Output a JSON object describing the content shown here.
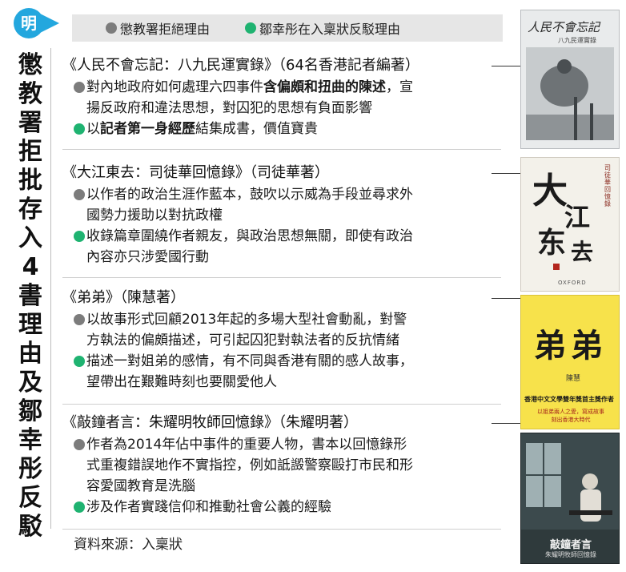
{
  "logo": {
    "text": "明",
    "color": "#23a7de"
  },
  "side_title": {
    "chars": [
      "懲",
      "教",
      "署",
      "拒",
      "批",
      "存",
      "入",
      "4",
      "書",
      "理",
      "由",
      "及",
      "鄒",
      "幸",
      "彤",
      "反",
      "駁"
    ]
  },
  "legend": {
    "grey_label": "懲教署拒絕理由",
    "green_label": "鄒幸彤在入稟狀反駁理由",
    "grey_color": "#7c7c7c",
    "green_color": "#1fb371"
  },
  "books": [
    {
      "title": "《人民不會忘記：八九民運實錄》（64名香港記者編著）",
      "reject_lines": [
        {
          "pre": "對內地政府如何處理六四事件",
          "bold": "含偏頗和扭曲的陳述",
          "post": "，宣"
        },
        {
          "pre": "揚反政府和違法思想，對囚犯的思想有負面影響",
          "bold": "",
          "post": ""
        }
      ],
      "rebut_lines": [
        {
          "pre": "以",
          "bold": "記者第一身經歷",
          "post": "結集成書，價值寶貴"
        }
      ],
      "cover": {
        "title": "人民不會忘記",
        "caption": "八九民運實錄"
      }
    },
    {
      "title": "《大江東去：司徒華回憶錄》（司徒華著）",
      "reject_lines": [
        {
          "pre": "以作者的政治生涯作藍本，鼓吹以示威為手段並尋求外",
          "bold": "",
          "post": ""
        },
        {
          "pre": "國勢力援助以對抗政權",
          "bold": "",
          "post": ""
        }
      ],
      "rebut_lines": [
        {
          "pre": "收錄篇章圍繞作者親友，與政治思想無關，即使有政治",
          "bold": "",
          "post": ""
        },
        {
          "pre": "內容亦只涉愛國行動",
          "bold": "",
          "post": ""
        }
      ],
      "cover": {
        "title_chars": [
          "大",
          "江",
          "东",
          "去"
        ],
        "caption": "司徒華回憶錄",
        "publisher": "OXFORD"
      }
    },
    {
      "title": "《弟弟》（陳慧著）",
      "reject_lines": [
        {
          "pre": "以故事形式回顧2013年起的多場大型社會動亂，對警",
          "bold": "",
          "post": ""
        },
        {
          "pre": "方執法的偏頗描述，可引起囚犯對執法者的反抗情緒",
          "bold": "",
          "post": ""
        }
      ],
      "rebut_lines": [
        {
          "pre": "描述一對姐弟的感情，有不同與香港有關的感人故事，",
          "bold": "",
          "post": ""
        },
        {
          "pre": "望帶出在艱難時刻也要關愛他人",
          "bold": "",
          "post": ""
        }
      ],
      "cover": {
        "title": "弟弟",
        "author": "陳慧",
        "award": "香港中文文學雙年獎首主獎作者",
        "blurb": "以姐弟兩人之愛，寫成故事 刻出香港大時代"
      }
    },
    {
      "title": "《敲鐘者言：朱耀明牧師回憶錄》（朱耀明著）",
      "reject_lines": [
        {
          "pre": "作者為2014年佔中事件的重要人物，書本以回憶錄形",
          "bold": "",
          "post": ""
        },
        {
          "pre": "式重複錯誤地作不實指控，例如詆譭警察毆打市民和形",
          "bold": "",
          "post": ""
        },
        {
          "pre": "容愛國教育是洗腦",
          "bold": "",
          "post": ""
        }
      ],
      "rebut_lines": [
        {
          "pre": "涉及作者實踐信仰和推動社會公義的經驗",
          "bold": "",
          "post": ""
        }
      ],
      "cover": {
        "title": "敲鐘者言",
        "caption": "朱耀明牧師回憶錄"
      }
    }
  ],
  "source": "資料來源：入稟狀"
}
